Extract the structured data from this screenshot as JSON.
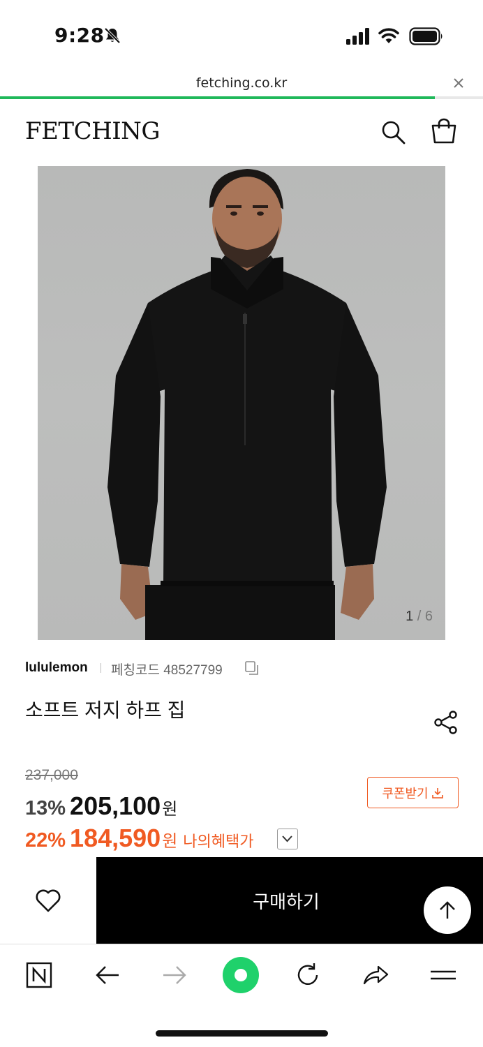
{
  "status_bar": {
    "time": "9:28",
    "icons": [
      "bell-muted-icon",
      "cellular-signal-icon",
      "wifi-icon",
      "battery-icon"
    ]
  },
  "browser": {
    "url": "fetching.co.kr",
    "load_progress": 0.9,
    "progress_color": "#1fb85a",
    "toolbar_icons": [
      "naver-n-icon",
      "back-arrow-icon",
      "forward-arrow-icon",
      "green-dot-icon",
      "reload-icon",
      "share-arrow-icon",
      "menu-icon"
    ]
  },
  "header": {
    "logo": "FETCHING",
    "icons": [
      "search-icon",
      "shopping-bag-icon"
    ]
  },
  "product": {
    "image_alt": "black half-zip pullover on model",
    "image_index": "1",
    "image_separator": " / ",
    "image_total": "6",
    "brand": "lululemon",
    "code_label": "페칭코드 48527799",
    "title": "소프트 저지 하프 집"
  },
  "pricing": {
    "original_price": "237,000",
    "discount_pct": "13%",
    "sale_price": "205,100",
    "currency": "원",
    "benefit_pct": "22%",
    "benefit_price": "184,590",
    "benefit_currency": "원",
    "benefit_label": "나의혜택가",
    "coupon_label": "쿠폰받기",
    "accent_color": "#f05a22"
  },
  "actions": {
    "buy_label": "구매하기"
  }
}
